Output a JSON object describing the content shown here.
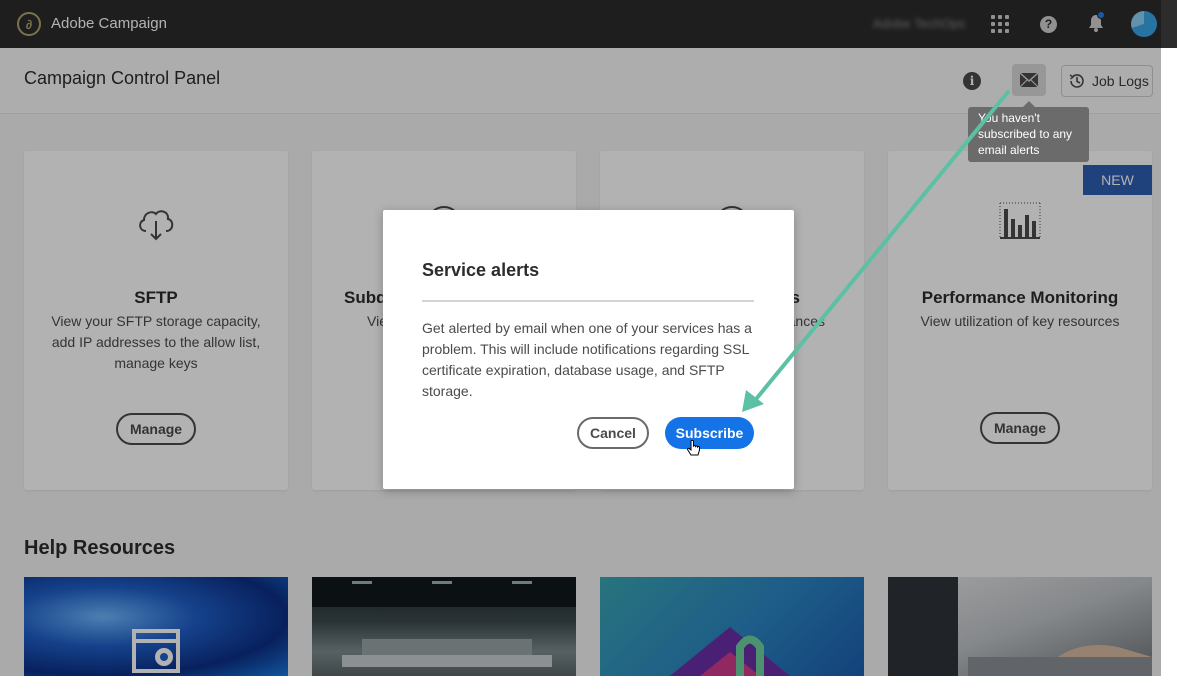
{
  "topbar": {
    "app_title": "Adobe Campaign",
    "org_name": "Adobe TechOps",
    "logo_icon": "adobe-campaign-logo",
    "icons": [
      "apps-grid-icon",
      "help-icon",
      "bell-icon",
      "avatar"
    ],
    "notification_dot_color": "#2680eb"
  },
  "header": {
    "title": "Campaign Control Panel",
    "job_logs_label": "Job Logs"
  },
  "tooltip": {
    "text": "You haven't subscribed to any email alerts"
  },
  "cards": [
    {
      "title": "SFTP",
      "description": "View your SFTP storage capacity, add IP addresses to the allow list, manage keys",
      "button": "Manage",
      "icon": "cloud-download-icon"
    },
    {
      "title": "Subd",
      "description": "Vie",
      "icon": "globe-icon"
    },
    {
      "title": "s",
      "description": "ances",
      "icon": "globe-icon"
    },
    {
      "title": "Performance Monitoring",
      "description": "View utilization of key resources",
      "button": "Manage",
      "badge": "NEW",
      "icon": "bar-chart-icon"
    }
  ],
  "help_resources": {
    "heading": "Help Resources"
  },
  "dialog": {
    "title": "Service alerts",
    "body": "Get alerted by email when one of your services has a problem. This will include notifications regarding SSL certificate expiration, database usage, and SFTP storage.",
    "cancel_label": "Cancel",
    "subscribe_label": "Subscribe"
  },
  "colors": {
    "topbar_bg": "#2c2c2c",
    "primary_blue": "#1473e6",
    "badge_blue": "#2d5fb4",
    "annotation_arrow": "#5cc0a4"
  }
}
